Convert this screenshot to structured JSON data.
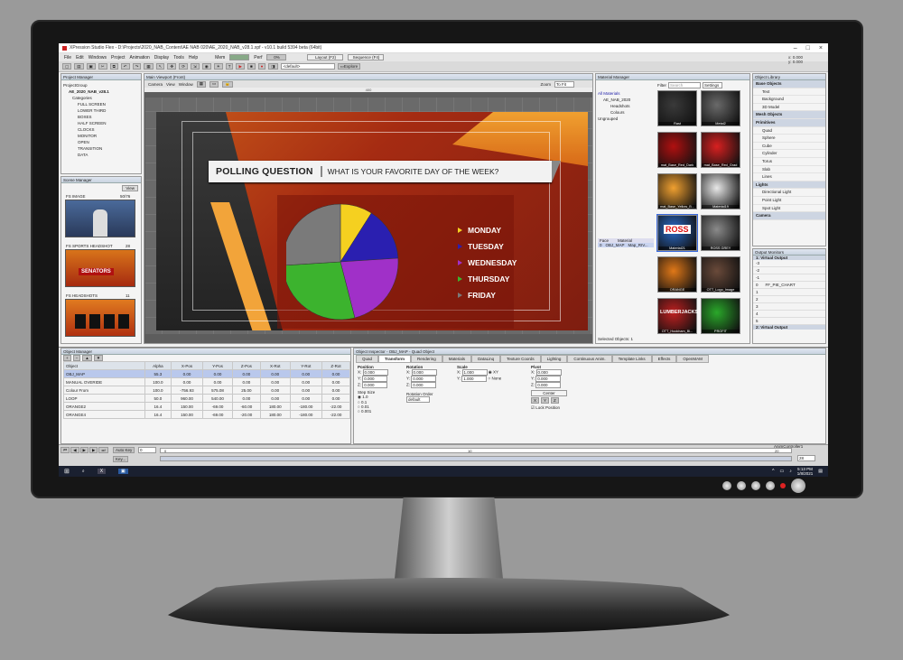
{
  "app": {
    "title": "XPression Studio Flex - D:\\Projects\\2020_NAB_Content\\AE NAB 020\\AE_2020_NAB_v28.1.xpf - v10.1 build 5394 beta (64bit)",
    "menu": [
      "File",
      "Edit",
      "Windows",
      "Project",
      "Animation",
      "Display",
      "Tools",
      "Help"
    ],
    "toolbar": {
      "mem_label": "Mem",
      "perf_label": "Perf",
      "perf_value": "0%",
      "layout_tab": "Layout (F2)",
      "sequence_tab": "Sequence (F4)",
      "default_select": "<default>",
      "explore_btn": "Explore"
    }
  },
  "project_manager": {
    "title": "Project Manager",
    "root": "ProjectGroup",
    "project": "AE_2020_NAB_v28.1",
    "categories_label": "Categories",
    "categories": [
      "FULL SCREEN",
      "LOWER THIRD",
      "BOXES",
      "HALF SCREEN",
      "CLOCKS",
      "MONITOR",
      "OPEN",
      "TRANSITION",
      "DATA"
    ]
  },
  "scene_manager": {
    "title": "Scene Manager",
    "view_btn": "View",
    "scenes": [
      {
        "name": "FS IMAGE",
        "id": "50/76"
      },
      {
        "name": "FS SPORTS HEADSHOT",
        "id": "28"
      },
      {
        "name": "FS HEADSHOTS",
        "id": "11"
      }
    ],
    "thumb_text": {
      "senators": "SENATORS"
    }
  },
  "viewport": {
    "title": "Main Viewport (Front)",
    "menu": [
      "Camera",
      "View",
      "Window"
    ],
    "zoom_label": "Zoom",
    "zoom_value": "To Fit",
    "ruler_value": "400"
  },
  "graphic": {
    "question_title": "POLLING QUESTION",
    "question_text": "WHAT IS YOUR FAVORITE DAY OF THE WEEK?",
    "legend": [
      {
        "label": "MONDAY",
        "color": "#f5d020"
      },
      {
        "label": "TUESDAY",
        "color": "#2a1fb0"
      },
      {
        "label": "WEDNESDAY",
        "color": "#a030c8"
      },
      {
        "label": "THURSDAY",
        "color": "#3cb32e"
      },
      {
        "label": "FRIDAY",
        "color": "#7a7a7a"
      }
    ]
  },
  "chart_data": {
    "type": "pie",
    "categories": [
      "MONDAY",
      "TUESDAY",
      "WEDNESDAY",
      "THURSDAY",
      "FRIDAY"
    ],
    "values": [
      9,
      15,
      22,
      28,
      26
    ],
    "colors": [
      "#f5d020",
      "#2a1fb0",
      "#a030c8",
      "#3cb32e",
      "#7a7a7a"
    ],
    "title": "",
    "legend": "right"
  },
  "material_manager": {
    "title": "Material Manager",
    "filter_label": "Filter",
    "search_placeholder": "Search",
    "settings_btn": "Settings",
    "tree": [
      "All Materials",
      "AE_NAB_2020",
      "Headshots",
      "Colours",
      "Ungrouped"
    ],
    "face_col": "Face",
    "material_col": "Material",
    "face_row": {
      "index": "0",
      "face": "OBJ_MAP",
      "material": "Map_RIV..."
    },
    "selected_objects": "Selected Objects: 1",
    "materials": [
      {
        "name": "Rast",
        "color": "#3a3a3a"
      },
      {
        "name": "Metal2",
        "color": "#6a6a6a"
      },
      {
        "name": "mat_Base_Red_Dark",
        "color": "#b01010"
      },
      {
        "name": "mat_Base_Red_Grad",
        "color": "#d82020"
      },
      {
        "name": "mat_Base_Yellow_B...",
        "color": "#f0a030"
      },
      {
        "name": "Material19",
        "color": "#e8e8e8"
      },
      {
        "name": "Material21",
        "color": "#2a6ac8"
      },
      {
        "name": "ROSS GREY",
        "color": "#8a8a8a"
      },
      {
        "name": "ORANGE",
        "color": "#e07818"
      },
      {
        "name": "OTT_Logo_Image",
        "color": "#6a4a3a"
      },
      {
        "name": "OTT_Hookham_Bl...",
        "color": "#c02020"
      },
      {
        "name": "PROFIT",
        "color": "#2aa82a"
      }
    ],
    "tile_texts": {
      "ross": "ROSS",
      "lumberjacks": "LUMBERJACKS"
    }
  },
  "object_library": {
    "title": "Object Library",
    "coords": {
      "x": "x: 0.000",
      "y": "y: 0.000"
    },
    "groups": [
      {
        "header": "Base Objects",
        "items": [
          "Text",
          "Background",
          "3D Model"
        ]
      },
      {
        "header": "Mesh Objects",
        "items": []
      },
      {
        "header": "Primitives",
        "items": [
          "Quad",
          "Sphere",
          "Cube",
          "Cylinder",
          "Torus",
          "Slab",
          "Lines"
        ]
      },
      {
        "header": "Lights",
        "items": [
          "Directional Light",
          "Point Light",
          "Spot Light"
        ]
      },
      {
        "header": "Camera",
        "items": []
      }
    ]
  },
  "output_monitors": {
    "title": "Output Monitors",
    "out1": "1: Virtual Output",
    "rows": [
      "-3",
      "-2",
      "-1",
      "0",
      "1",
      "2",
      "3",
      "4",
      "5"
    ],
    "item": "FF_PIE_CHART",
    "out2": "2: Virtual Output"
  },
  "object_manager": {
    "title": "Object Manager",
    "columns": [
      "Object",
      "Alpha",
      "X-Pos",
      "Y-Pos",
      "Z-Pos",
      "X-Rot",
      "Y-Rot",
      "Z-Rot"
    ],
    "rows": [
      {
        "name": "OBJ_MAP",
        "vals": [
          "55.3",
          "0.00",
          "0.00",
          "0.00",
          "0.00",
          "0.00",
          "0.00"
        ],
        "sel": true
      },
      {
        "name": "MANUAL OVERIDE",
        "vals": [
          "100.0",
          "0.00",
          "0.00",
          "0.00",
          "0.00",
          "0.00",
          "0.00"
        ]
      },
      {
        "name": "Colour From",
        "vals": [
          "100.0",
          "-756.93",
          "575.08",
          "25.00",
          "0.00",
          "0.00",
          "0.00"
        ]
      },
      {
        "name": "LOOP",
        "vals": [
          "50.0",
          "960.00",
          "540.00",
          "0.00",
          "0.00",
          "0.00",
          "0.00"
        ]
      },
      {
        "name": "ORANGE2",
        "vals": [
          "16.4",
          "150.00",
          "-69.00",
          "-60.00",
          "180.00",
          "-180.00",
          "-22.00"
        ]
      },
      {
        "name": "ORANGE4",
        "vals": [
          "16.4",
          "150.00",
          "-69.00",
          "-20.00",
          "180.00",
          "-180.00",
          "-22.00"
        ]
      }
    ]
  },
  "object_inspector": {
    "title": "Object Inspector - OBJ_MAP - Quad Object",
    "tabs": [
      "Quad",
      "Transform",
      "Rendering",
      "Materials",
      "DataLinq",
      "Texture Coords",
      "Lighting",
      "Continuous Anim.",
      "Template Links",
      "Effects",
      "OpenMAM"
    ],
    "position": {
      "label": "Position",
      "x": "0.000",
      "y": "0.000",
      "z": "0.000"
    },
    "rotation": {
      "label": "Rotation",
      "x": "0.000",
      "y": "0.000",
      "z": "0.000"
    },
    "scale": {
      "label": "Scale",
      "x": "1.000",
      "y": "1.000",
      "xy_label": "XY",
      "none_label": "None"
    },
    "pivot": {
      "label": "Pivot",
      "x": "0.000",
      "y": "0.000",
      "z": "0.000"
    },
    "step_size": {
      "label": "Step Size",
      "options": [
        "1.0",
        "0.1",
        "0.01",
        "0.001"
      ]
    },
    "rotation_order": {
      "label": "Rotation Order",
      "value": "default"
    },
    "center": {
      "label": "Center",
      "x": "X",
      "y": "Y",
      "z": "Z"
    },
    "lock_position": "Lock Position"
  },
  "timeline": {
    "auto_key": "Auto Key",
    "key_label": "Key...",
    "frame_value": "0",
    "frames": [
      "0",
      "10",
      "20"
    ],
    "anim_controller": "AnimController1",
    "end_frame": "28"
  },
  "taskbar": {
    "time": "5:13 PM",
    "date": "1/8/2021"
  }
}
